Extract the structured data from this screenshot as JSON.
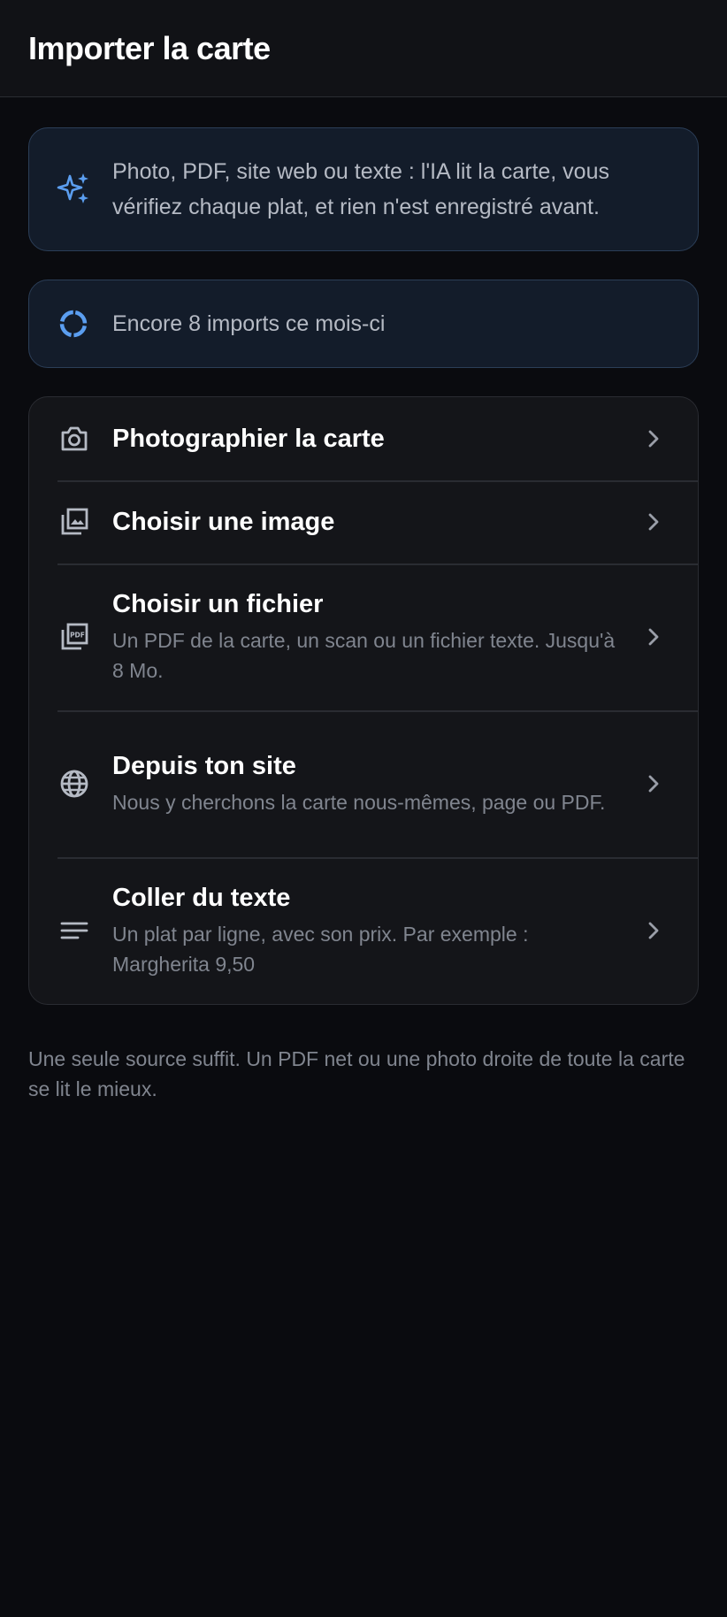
{
  "header": {
    "title": "Importer la carte"
  },
  "ai_banner": {
    "icon": "sparkles-icon",
    "text": "Photo, PDF, site web ou texte : l'IA lit la carte, vous vérifiez chaque plat, et rien n'est enregistré avant."
  },
  "quota": {
    "icon": "progress-ring-icon",
    "text": "Encore 8 imports ce mois-ci"
  },
  "options": [
    {
      "icon": "camera-icon",
      "title": "Photographier la carte",
      "subtitle": ""
    },
    {
      "icon": "image-gallery-icon",
      "title": "Choisir une image",
      "subtitle": ""
    },
    {
      "icon": "pdf-file-icon",
      "title": "Choisir un fichier",
      "subtitle": "Un PDF de la carte, un scan ou un fichier texte. Jusqu'à 8 Mo."
    },
    {
      "icon": "globe-icon",
      "title": "Depuis ton site",
      "subtitle": "Nous y cherchons la carte nous-mêmes, page ou PDF."
    },
    {
      "icon": "text-lines-icon",
      "title": "Coller du texte",
      "subtitle": "Un plat par ligne, avec son prix. Par exemple : Margherita 9,50"
    }
  ],
  "footnote": "Une seule source suffit. Un PDF net ou une photo droite de toute la carte se lit le mieux.",
  "colors": {
    "background": "#0a0b0f",
    "header_bg": "#111216",
    "accent_blue": "#5b9ef0",
    "info_card_bg": "#131c2a",
    "info_card_border": "#2b3e57",
    "options_card_bg": "#141519",
    "muted_text": "#80858f",
    "icon_gray": "#b5bac4"
  }
}
